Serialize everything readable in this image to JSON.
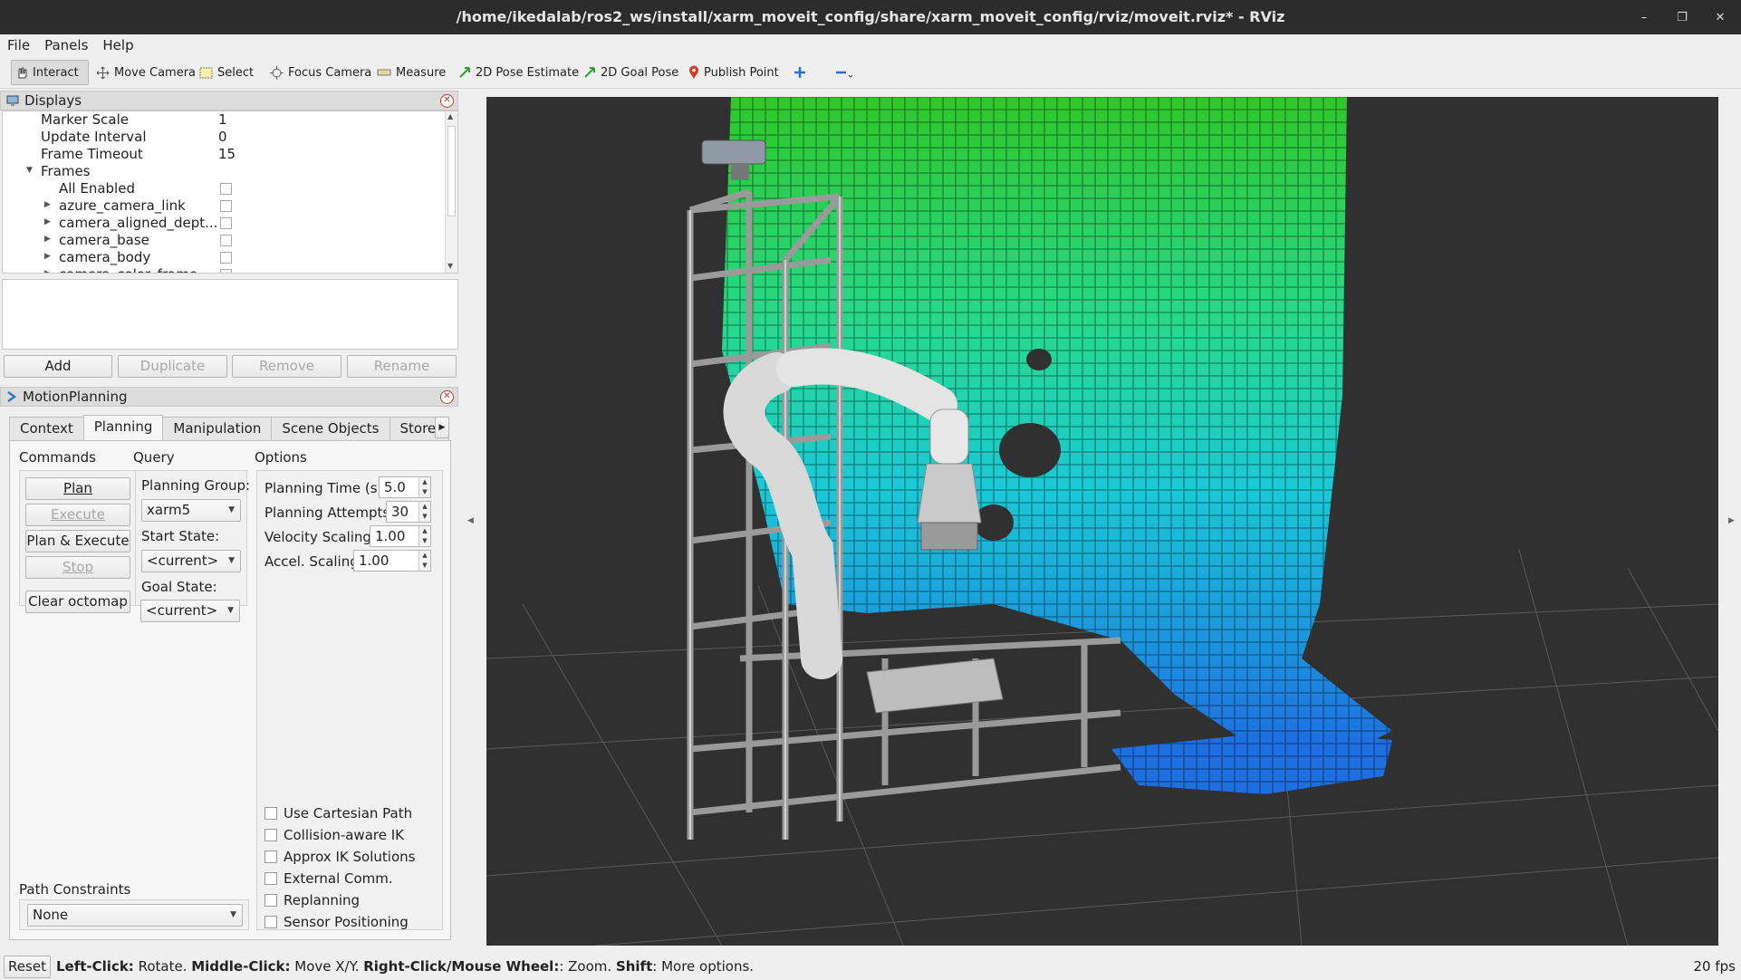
{
  "window": {
    "title": "/home/ikedalab/ros2_ws/install/xarm_moveit_config/share/xarm_moveit_config/rviz/moveit.rviz* - RViz"
  },
  "menu": [
    "File",
    "Panels",
    "Help"
  ],
  "toolbar": {
    "interact": "Interact",
    "move_camera": "Move Camera",
    "select": "Select",
    "focus_camera": "Focus Camera",
    "measure": "Measure",
    "pose_estimate": "2D Pose Estimate",
    "goal_pose": "2D Goal Pose",
    "publish_point": "Publish Point"
  },
  "displays": {
    "title": "Displays",
    "rows": [
      {
        "name": "Marker Scale",
        "value": "1"
      },
      {
        "name": "Update Interval",
        "value": "0"
      },
      {
        "name": "Frame Timeout",
        "value": "15"
      },
      {
        "name": "Frames",
        "value": ""
      },
      {
        "name": "All Enabled",
        "value": ""
      },
      {
        "name": "azure_camera_link",
        "value": ""
      },
      {
        "name": "camera_aligned_dept...",
        "value": ""
      },
      {
        "name": "camera_base",
        "value": ""
      },
      {
        "name": "camera_body",
        "value": ""
      },
      {
        "name": "camera_color_frame",
        "value": ""
      }
    ],
    "buttons": {
      "add": "Add",
      "duplicate": "Duplicate",
      "remove": "Remove",
      "rename": "Rename"
    }
  },
  "motion_planning": {
    "title": "MotionPlanning",
    "tabs": [
      "Context",
      "Planning",
      "Manipulation",
      "Scene Objects",
      "Stored"
    ],
    "active_tab": "Planning",
    "commands": {
      "label": "Commands",
      "plan": "Plan",
      "execute": "Execute",
      "plan_execute": "Plan & Execute",
      "stop": "Stop",
      "clear_octomap": "Clear octomap"
    },
    "query": {
      "label": "Query",
      "planning_group_label": "Planning Group:",
      "planning_group": "xarm5",
      "start_state_label": "Start State:",
      "start_state": "<current>",
      "goal_state_label": "Goal State:",
      "goal_state": "<current>"
    },
    "options": {
      "label": "Options",
      "planning_time_label": "Planning Time (s):",
      "planning_time": "5.0",
      "planning_attempts_label": "Planning Attempts:",
      "planning_attempts": "30",
      "velocity_scaling_label": "Velocity Scaling:",
      "velocity_scaling": "1.00",
      "accel_scaling_label": "Accel. Scaling:",
      "accel_scaling": "1.00",
      "checkboxes": [
        "Use Cartesian Path",
        "Collision-aware IK",
        "Approx IK Solutions",
        "External Comm.",
        "Replanning",
        "Sensor Positioning"
      ]
    },
    "path_constraints": {
      "label": "Path Constraints",
      "value": "None"
    }
  },
  "status": {
    "reset": "Reset",
    "hint_parts": [
      "Left-Click:",
      " Rotate. ",
      "Middle-Click:",
      " Move X/Y. ",
      "Right-Click/Mouse Wheel:",
      ": Zoom. ",
      "Shift",
      ": More options."
    ],
    "fps": "20 fps"
  },
  "colors": {
    "viewport_bg": "#303030",
    "voxel_top": "#2ecc2e",
    "voxel_mid": "#1fd6b0",
    "voxel_bottom": "#1e7ae0",
    "frame_metal": "#b8b8b8",
    "robot_arm": "#e8e8e8"
  }
}
